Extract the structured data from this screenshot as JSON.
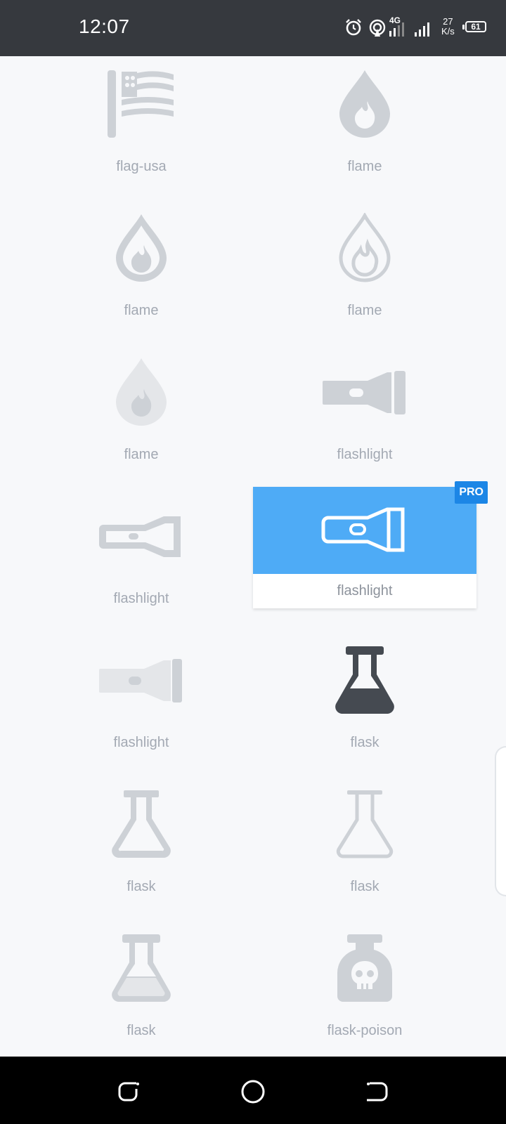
{
  "status_bar": {
    "time": "12:07",
    "speed_value": "27",
    "speed_unit": "K/s",
    "network": "4G",
    "battery": "61",
    "icons": [
      "alarm-icon",
      "hotspot-icon",
      "signal-4g-icon",
      "signal-icon",
      "battery-icon"
    ]
  },
  "icons_grid": {
    "items": [
      {
        "label": "flag-usa",
        "icon": "flag-usa-icon"
      },
      {
        "label": "flame",
        "icon": "flame-solid-icon"
      },
      {
        "label": "flame",
        "icon": "flame-regular-icon"
      },
      {
        "label": "flame",
        "icon": "flame-light-icon"
      },
      {
        "label": "flame",
        "icon": "flame-duotone-icon"
      },
      {
        "label": "flashlight",
        "icon": "flashlight-solid-icon"
      },
      {
        "label": "flashlight",
        "icon": "flashlight-regular-icon"
      },
      {
        "label": "flashlight",
        "icon": "flashlight-light-icon",
        "selected": true,
        "badge": "PRO"
      },
      {
        "label": "flashlight",
        "icon": "flashlight-duotone-icon"
      },
      {
        "label": "flask",
        "icon": "flask-solid-icon"
      },
      {
        "label": "flask",
        "icon": "flask-regular-icon"
      },
      {
        "label": "flask",
        "icon": "flask-light-icon"
      },
      {
        "label": "flask",
        "icon": "flask-duotone-icon"
      },
      {
        "label": "flask-poison",
        "icon": "flask-poison-icon"
      }
    ]
  },
  "nav_bar": {
    "buttons": [
      "recent-apps-icon",
      "home-icon",
      "back-icon"
    ]
  },
  "colors": {
    "icon_gray": "#cdd1d6",
    "icon_light": "#e4e6e9",
    "icon_dark": "#454a51",
    "selected_bg": "#4eabf6",
    "badge_bg": "#1c86e6"
  }
}
